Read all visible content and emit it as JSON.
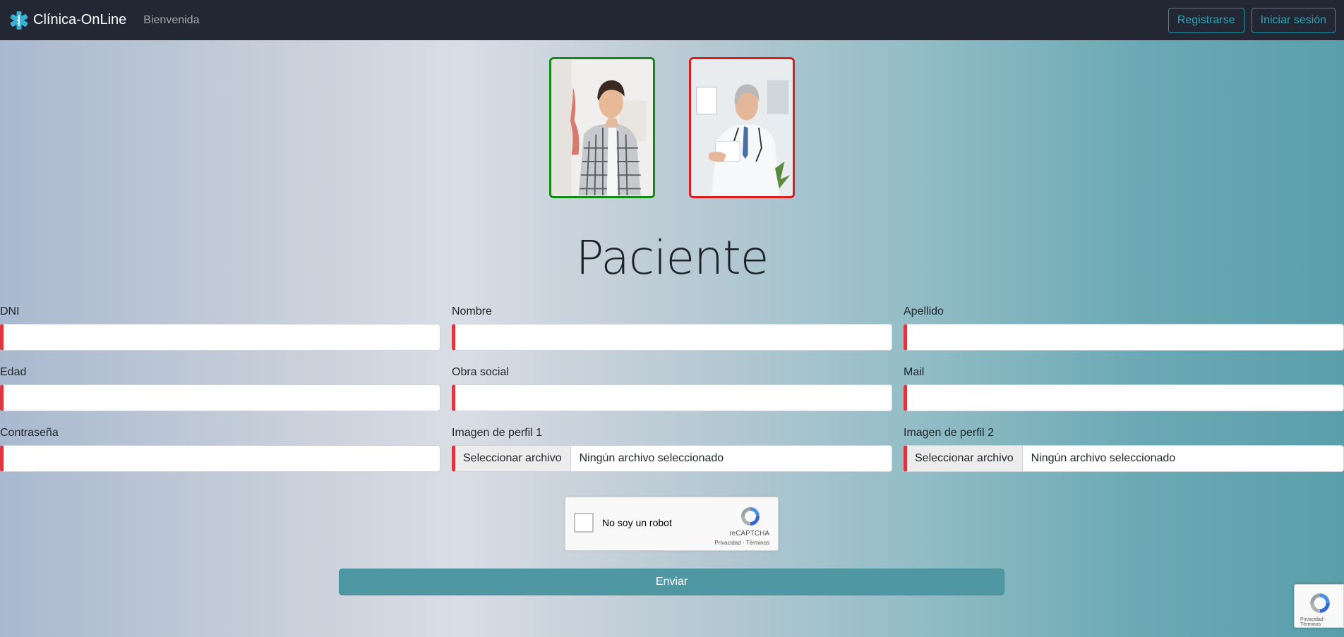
{
  "navbar": {
    "brand": "Clínica-OnLine",
    "welcome_link": "Bienvenida",
    "register_button": "Registrarse",
    "login_button": "Iniciar sesión",
    "brand_icon": "medical-star-icon"
  },
  "profile_options": [
    {
      "name": "paciente",
      "border_color": "#138a18"
    },
    {
      "name": "medico",
      "border_color": "#dc1d1d"
    }
  ],
  "form": {
    "title": "Paciente",
    "fields": {
      "dni": {
        "label": "DNI",
        "value": ""
      },
      "nombre": {
        "label": "Nombre",
        "value": ""
      },
      "apellido": {
        "label": "Apellido",
        "value": ""
      },
      "edad": {
        "label": "Edad",
        "value": ""
      },
      "obra_social": {
        "label": "Obra social",
        "value": ""
      },
      "mail": {
        "label": "Mail",
        "value": ""
      },
      "contrasena": {
        "label": "Contraseña",
        "value": ""
      },
      "imagen1": {
        "label": "Imagen de perfil 1",
        "button": "Seleccionar archivo",
        "status": "Ningún archivo seleccionado"
      },
      "imagen2": {
        "label": "Imagen de perfil 2",
        "button": "Seleccionar archivo",
        "status": "Ningún archivo seleccionado"
      }
    },
    "captcha": {
      "label": "No soy un robot",
      "brand": "reCAPTCHA",
      "links": "Privacidad - Términos",
      "checked": false
    },
    "submit_label": "Enviar"
  },
  "recaptcha_badge": {
    "links": "Privacidad - Términos"
  },
  "colors": {
    "navbar_bg": "#222733",
    "accent": "#1f97a8",
    "invalid_field": "#e0353f",
    "submit_bg": "#4f97a2"
  }
}
